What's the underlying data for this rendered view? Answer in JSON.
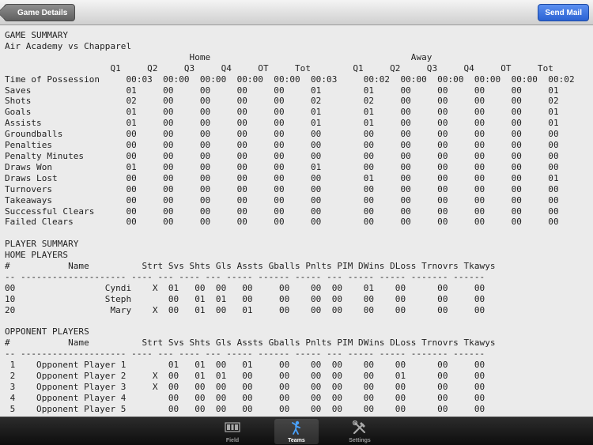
{
  "nav": {
    "back_label": "Game Details",
    "action_label": "Send Mail"
  },
  "report_lines": [
    "GAME SUMMARY",
    "Air Academy vs Chapparel",
    "                                   Home                                      Away",
    "                    Q1     Q2     Q3     Q4     OT     Tot        Q1     Q2     Q3     Q4     OT     Tot",
    "Time of Possession     00:03  00:00  00:00  00:00  00:00  00:03     00:02  00:00  00:00  00:00  00:00  00:02",
    "Saves                  01     00     00     00     00     01        01     00     00     00     00     01",
    "Shots                  02     00     00     00     00     02        02     00     00     00     00     02",
    "Goals                  01     00     00     00     00     01        01     00     00     00     00     01",
    "Assists                01     00     00     00     00     01        01     00     00     00     00     01",
    "Groundballs            00     00     00     00     00     00        00     00     00     00     00     00",
    "Penalties              00     00     00     00     00     00        00     00     00     00     00     00",
    "Penalty Minutes        00     00     00     00     00     00        00     00     00     00     00     00",
    "Draws Won              01     00     00     00     00     01        00     00     00     00     00     00",
    "Draws Lost             00     00     00     00     00     00        01     00     00     00     00     01",
    "Turnovers              00     00     00     00     00     00        00     00     00     00     00     00",
    "Takeaways              00     00     00     00     00     00        00     00     00     00     00     00",
    "Successful Clears      00     00     00     00     00     00        00     00     00     00     00     00",
    "Failed Clears          00     00     00     00     00     00        00     00     00     00     00     00",
    "",
    "PLAYER SUMMARY",
    "HOME PLAYERS",
    "#           Name          Strt Svs Shts Gls Assts Gballs Pnlts PIM DWins DLoss Trnovrs Tkawys",
    "-- -------------------- ---- --- ---- --- ----- ------ ----- --- ----- ----- ------- ------",
    "00                 Cyndi    X  01   00  00   00     00    00  00    01    00      00     00",
    "10                 Steph       00   01  01   00     00    00  00    00    00      00     00",
    "20                  Mary    X  00   01  00   01     00    00  00    00    00      00     00",
    "",
    "OPPONENT PLAYERS",
    "#           Name          Strt Svs Shts Gls Assts Gballs Pnlts PIM DWins DLoss Trnovrs Tkawys",
    "-- -------------------- ---- --- ---- --- ----- ------ ----- --- ----- ----- ------- ------",
    " 1    Opponent Player 1        01   01  00   01     00    00  00    00    00      00     00",
    " 2    Opponent Player 2     X  00   01  01   00     00    00  00    00    01      00     00",
    " 3    Opponent Player 3     X  00   00  00   00     00    00  00    00    00      00     00",
    " 4    Opponent Player 4        00   00  00   00     00    00  00    00    00      00     00",
    " 5    Opponent Player 5        00   00  00   00     00    00  00    00    00      00     00"
  ],
  "tabs": [
    {
      "label": "Field",
      "icon": "scoreboard-icon",
      "active": false
    },
    {
      "label": "Teams",
      "icon": "lacrosse-player-icon",
      "active": true
    },
    {
      "label": "Settings",
      "icon": "tools-icon",
      "active": false
    }
  ]
}
